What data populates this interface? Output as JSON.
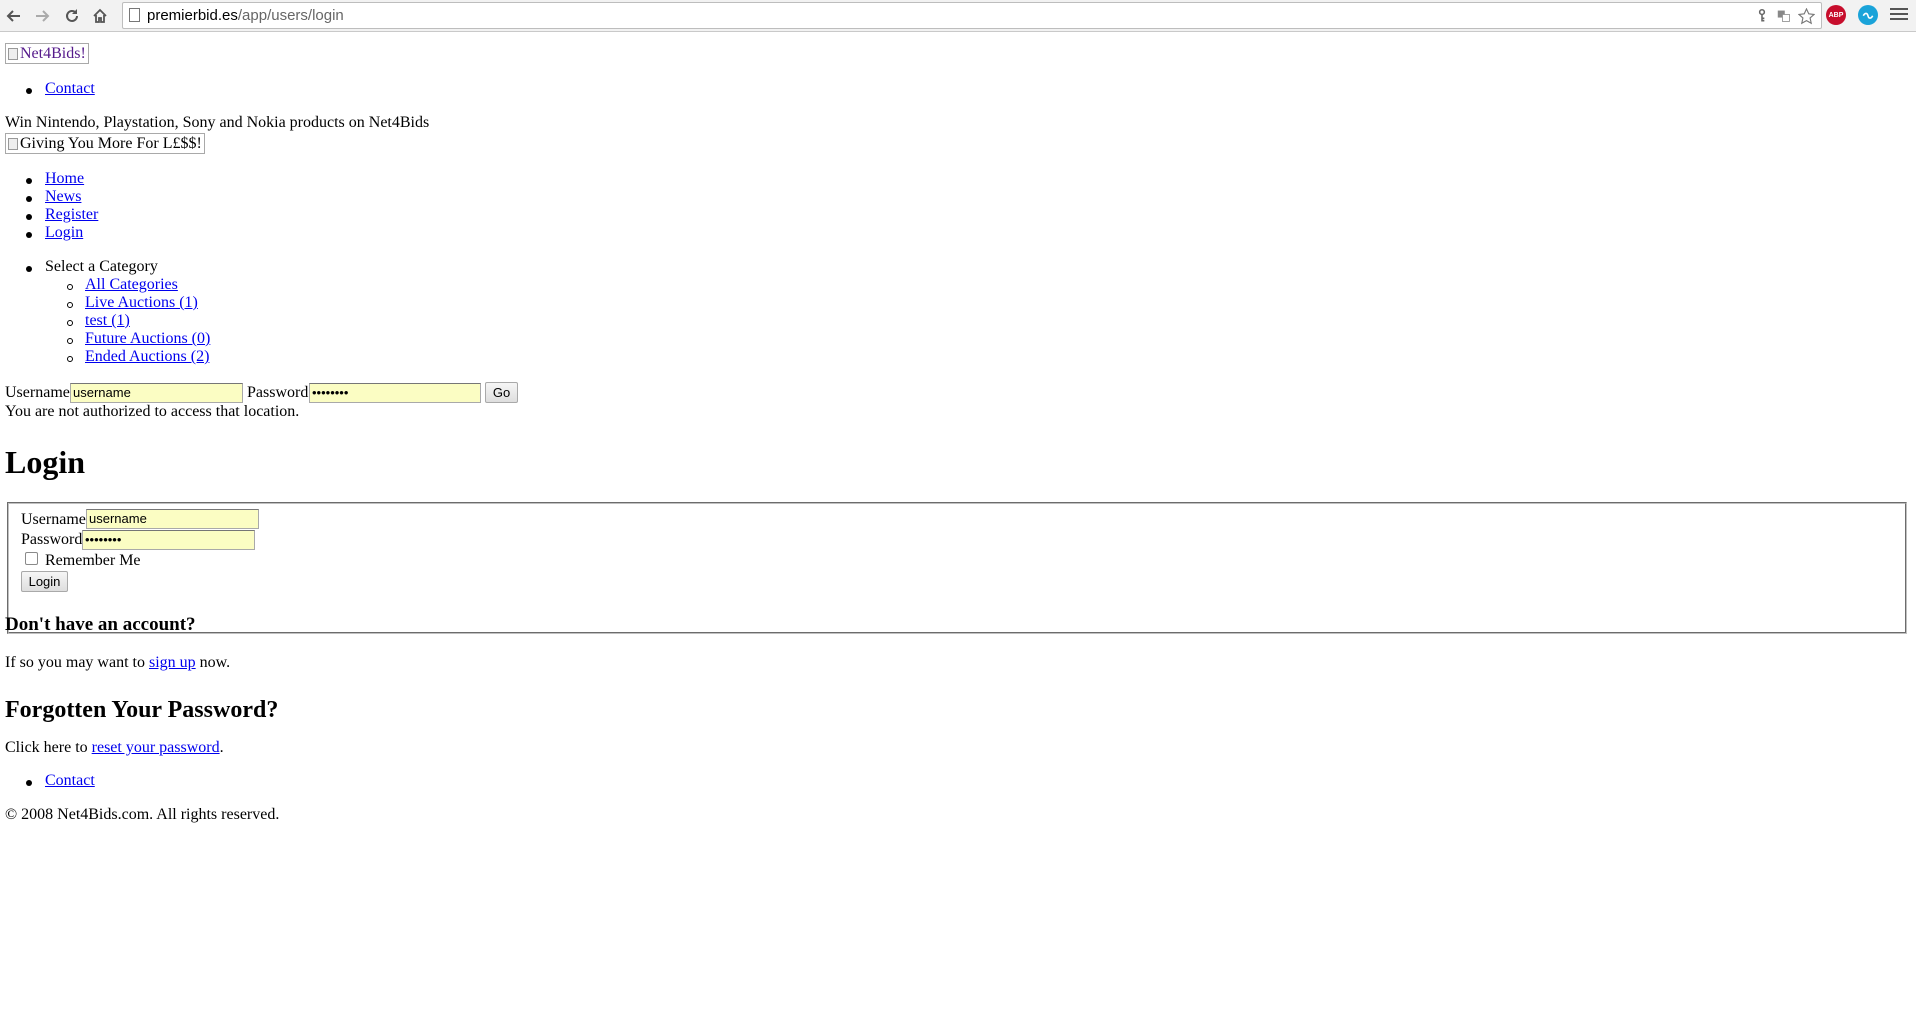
{
  "browser": {
    "url_host": "premierbid.es",
    "url_path": "/app/users/login",
    "extensions": [
      {
        "name": "adblock-plus",
        "label": "ABP",
        "color": "#c70d2c"
      },
      {
        "name": "extension-2",
        "label": "",
        "color": "#1aa3d9"
      }
    ]
  },
  "header": {
    "logo_alt": "Net4Bids!",
    "top_links": [
      "Contact"
    ],
    "tagline": "Win Nintendo, Playstation, Sony and Nokia products on Net4Bids",
    "slogan_alt": "Giving You More For L£$$!"
  },
  "nav": {
    "items": [
      "Home",
      "News",
      "Register",
      "Login"
    ]
  },
  "categories": {
    "heading": "Select a Category",
    "items": [
      "All Categories",
      "Live Auctions (1)",
      "test (1)",
      "Future Auctions (0)",
      "Ended Auctions (2)"
    ]
  },
  "quick_login": {
    "username_label": "Username",
    "username_value": "username",
    "password_label": "Password",
    "password_value": "••••••••",
    "go_label": "Go"
  },
  "flash_message": "You are not authorized to access that location.",
  "login_form": {
    "title": "Login",
    "username_label": "Username",
    "username_value": "username",
    "password_label": "Password",
    "password_value": "••••••••",
    "remember_label": "Remember Me",
    "submit_label": "Login"
  },
  "signup": {
    "heading": "Don't have an account?",
    "text_before": "If so you may want to",
    "link": "sign up",
    "text_after": "now."
  },
  "forgot": {
    "heading": "Forgotten Your Password?",
    "text_before": "Click here to",
    "link": "reset your password",
    "text_after": "."
  },
  "footer": {
    "links": [
      "Contact"
    ],
    "copyright": "© 2008 Net4Bids.com. All rights reserved."
  }
}
